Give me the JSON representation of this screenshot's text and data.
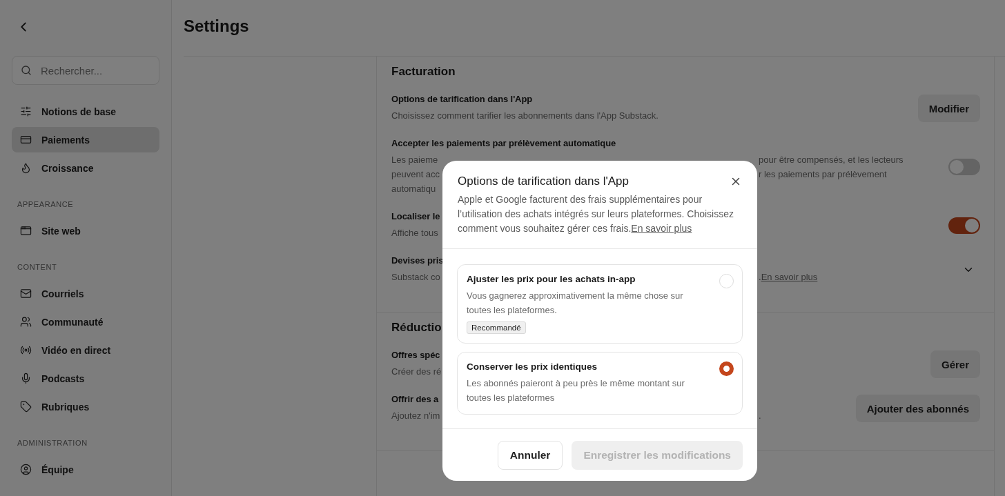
{
  "sidebar": {
    "search": {
      "placeholder": "Rechercher..."
    },
    "groups": [
      {
        "items": [
          {
            "label": "Notions de base",
            "selected": false
          },
          {
            "label": "Paiements",
            "selected": true
          },
          {
            "label": "Croissance",
            "selected": false
          }
        ]
      },
      {
        "heading": "APPEARANCE",
        "items": [
          {
            "label": "Site web",
            "selected": false
          }
        ]
      },
      {
        "heading": "CONTENT",
        "items": [
          {
            "label": "Courriels",
            "selected": false
          },
          {
            "label": "Communauté",
            "selected": false
          },
          {
            "label": "Vidéo en direct",
            "selected": false
          },
          {
            "label": "Podcasts",
            "selected": false
          },
          {
            "label": "Rubriques",
            "selected": false
          }
        ]
      },
      {
        "heading": "ADMINISTRATION",
        "items": [
          {
            "label": "Équipe",
            "selected": false
          }
        ]
      }
    ]
  },
  "page": {
    "title": "Settings"
  },
  "sections": [
    {
      "title": "Facturation",
      "rows": [
        {
          "title": "Options de tarification dans l'App",
          "lines": [
            {
              "text": "Choisissez comment tarifier les abonnements dans l'App Substack."
            }
          ],
          "control": {
            "kind": "button",
            "label": "Modifier"
          }
        },
        {
          "title": "Accepter les paiements par prélèvement automatique",
          "lines": [
            {
              "text": "Les paieme",
              "right": "pour être compensés, et les lecteurs"
            },
            {
              "text": "peuvent acc",
              "right": "r les paiements par prélèvement"
            },
            {
              "text": "automatiqu"
            }
          ],
          "control": {
            "kind": "toggle",
            "on": false
          }
        },
        {
          "title": "Localiser le",
          "lines": [
            {
              "text": "Affiche tous"
            }
          ],
          "control": {
            "kind": "toggle",
            "on": true
          }
        },
        {
          "title": "Devises pris",
          "lines": [
            {
              "text": "Substack co",
              "right": ".",
              "link": "En savoir plus"
            }
          ],
          "control": {
            "kind": "expander",
            "expanded": false
          }
        }
      ]
    },
    {
      "title": "Réductio",
      "rows": [
        {
          "title": "Offres spéc",
          "lines": [
            {
              "text": "Créer des ré"
            }
          ],
          "control": {
            "kind": "button",
            "label": "Gérer"
          }
        },
        {
          "title": "Offrir des a",
          "lines": [
            {
              "text": "Ajoutez n'im",
              "right": "."
            }
          ],
          "control": {
            "kind": "button",
            "label": "Ajouter des abonnés"
          }
        }
      ]
    }
  ],
  "dialog": {
    "title": "Options de tarification dans l'App",
    "description": "Apple et Google facturent des frais supplémentaires pour l’utilisation des achats intégrés sur leurs plateformes. Choisissez comment vous souhaitez gérer ces frais.",
    "link": "En savoir plus",
    "options": [
      {
        "title": "Ajuster les prix pour les achats in-app",
        "description": "Vous gagnerez approximativement la même chose sur toutes les plateformes.",
        "badge": "Recommandé",
        "selected": false
      },
      {
        "title": "Conserver les prix identiques",
        "description": "Les abonnés paieront à peu près le même montant sur toutes les plateformes",
        "selected": true
      }
    ],
    "buttons": [
      {
        "label": "Annuler",
        "kind": "secondary",
        "disabled": false
      },
      {
        "label": "Enregistrer les modifications",
        "kind": "primary",
        "disabled": true
      }
    ]
  }
}
